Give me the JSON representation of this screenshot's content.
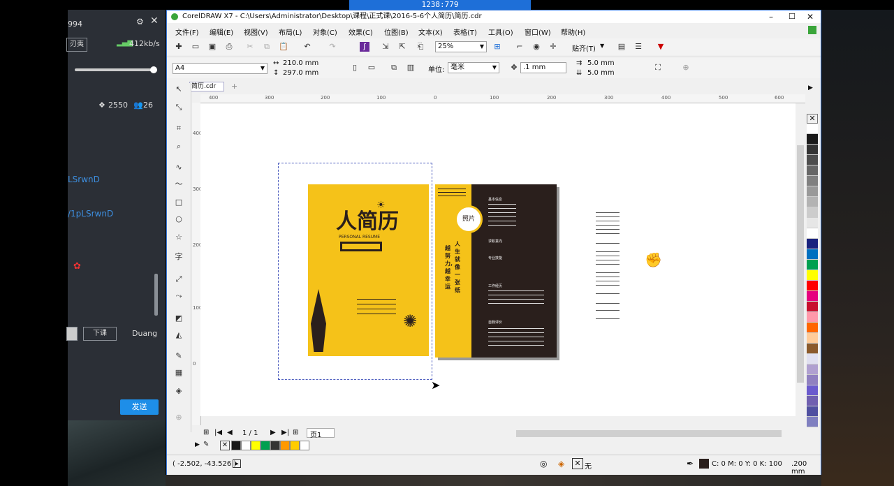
{
  "screen_title": "1238:779",
  "chat": {
    "id_fragment": "994",
    "left_button": "刃夷",
    "speed": "412kb/s",
    "likes": "2550",
    "users": "26",
    "link1": "LSrwnD",
    "link2": "/1pLSrwnD",
    "btn_down": "下课",
    "btn_duang": "Duang",
    "send": "发送"
  },
  "window": {
    "title": "CorelDRAW X7 - C:\\Users\\Administrator\\Desktop\\课程\\正式课\\2016-5-6个人简历\\简历.cdr",
    "minimize": "–",
    "maximize": "☐",
    "close": "✕"
  },
  "menu": [
    "文件(F)",
    "编辑(E)",
    "视图(V)",
    "布局(L)",
    "对象(C)",
    "效果(C)",
    "位图(B)",
    "文本(X)",
    "表格(T)",
    "工具(O)",
    "窗口(W)",
    "帮助(H)"
  ],
  "toolbar": {
    "zoom": "25%",
    "snap": "贴齐(T)"
  },
  "propbar": {
    "page_size": "A4",
    "width": "210.0 mm",
    "height": "297.0 mm",
    "unit_label": "单位:",
    "unit": "毫米",
    "nudge": ".1 mm",
    "dup_x": "5.0 mm",
    "dup_y": "5.0 mm"
  },
  "doc_tab": "简历.cdr",
  "ruler_h_labels": [
    "400",
    "300",
    "200",
    "100",
    "0",
    "100",
    "200",
    "300",
    "400",
    "500",
    "600"
  ],
  "ruler_v_labels": [
    "400",
    "300",
    "200",
    "100",
    "0"
  ],
  "page_nav": {
    "page": "1 / 1",
    "page_tab": "页1"
  },
  "status": {
    "coords": "( -2.502, -43.526 )",
    "fill": "无",
    "color_info": "C: 0 M: 0 Y: 0 K: 100",
    "outline": ".200 mm"
  },
  "resume": {
    "cover_title": "人简历",
    "cover_sub": "PERSONAL RESUME",
    "photo_label": "照片",
    "sections": [
      "基本信息",
      "求职意向",
      "专业技能",
      "工作经历",
      "自我评价"
    ],
    "motto1": "人生就像一张纸",
    "motto2": "越努力,越幸运"
  },
  "colors": {
    "accent_yellow": "#f5c219",
    "dark_brown": "#2a1f1c",
    "window_border": "#3c7de0"
  },
  "palette_colors": [
    "#ffffff",
    "#1a1a1a",
    "#333333",
    "#4d4d4d",
    "#666666",
    "#808080",
    "#999999",
    "#b3b3b3",
    "#cccccc",
    "#e6e6e6",
    "#ffffff",
    "#1a237e",
    "#0070c0",
    "#00a050",
    "#ffff00",
    "#ff0000",
    "#e6007e",
    "#c8102e",
    "#ff99aa",
    "#ff6600",
    "#ffcc99",
    "#8b5a2b",
    "#e0e0f0",
    "#b0a0d0",
    "#9080c0",
    "#6a5acd",
    "#7060b0",
    "#5050a0",
    "#8080c0",
    "#404080",
    "#606090"
  ],
  "bottom_swatches": [
    "#1a1a1a",
    "#ffffff",
    "#ffff00",
    "#00a050",
    "#333333",
    "#ff9900",
    "#ffcc00",
    "#ffffff"
  ]
}
